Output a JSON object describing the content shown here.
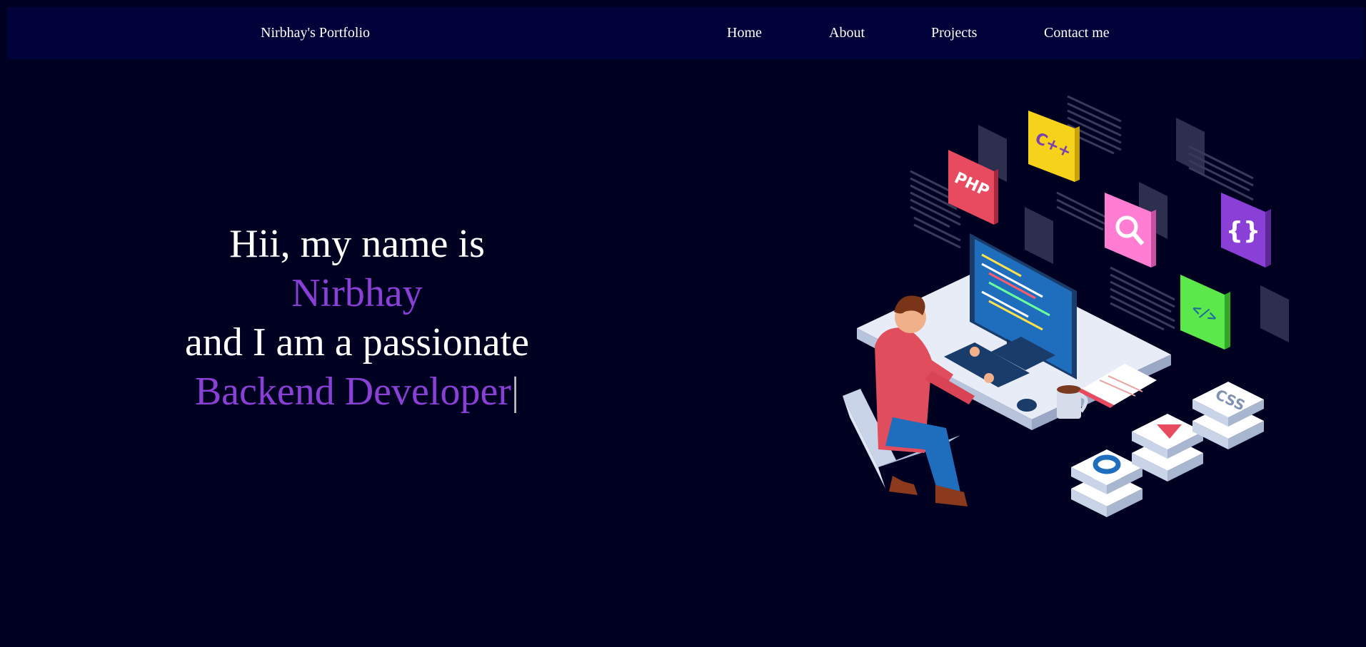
{
  "navbar": {
    "brand": "Nirbhay's Portfolio",
    "links": [
      {
        "label": "Home"
      },
      {
        "label": "About"
      },
      {
        "label": "Projects"
      },
      {
        "label": "Contact me"
      }
    ]
  },
  "hero": {
    "line1": "Hii, my name is",
    "name": "Nirbhay",
    "line3": "and I am a passionate",
    "role": "Backend Developer",
    "cursor": "|"
  },
  "illustration": {
    "icons": [
      "developer-at-desk-icon",
      "php-icon",
      "cpp-icon",
      "search-icon",
      "braces-icon",
      "code-tag-icon",
      "css-icon",
      "play-icon",
      "gear-icon"
    ],
    "labels": {
      "php": "PHP",
      "cpp": "C++",
      "css": "CSS"
    }
  },
  "colors": {
    "background": "#000020",
    "navbar": "#02023a",
    "accent": "#8a3fd6",
    "text": "#ffffff"
  }
}
